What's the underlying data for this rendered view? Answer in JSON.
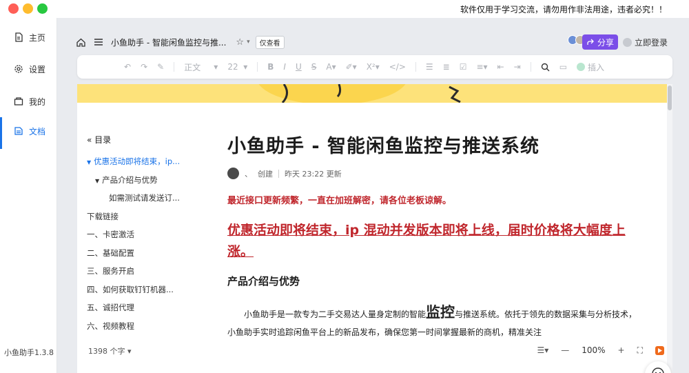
{
  "notice": "软件仅用于学习交流，请勿用作非法用途，违者必究！！",
  "sidebar": {
    "items": [
      {
        "label": "主页",
        "icon": "file-icon"
      },
      {
        "label": "设置",
        "icon": "gear-icon"
      },
      {
        "label": "我的",
        "icon": "folder-icon"
      },
      {
        "label": "文档",
        "icon": "doc-icon"
      }
    ],
    "version": "小鱼助手1.3.8"
  },
  "topbar": {
    "title": "小鱼助手 - 智能闲鱼监控与推...",
    "tag": "仅查看",
    "share_label": "分享",
    "login_label": "立即登录"
  },
  "toolbar": {
    "para_style": "正文",
    "font_size": "22",
    "insert_label": "插入"
  },
  "toc": {
    "header": "目录",
    "items": [
      {
        "label": "优惠活动即将结束，ip...",
        "level": 1,
        "active": true,
        "caret": true
      },
      {
        "label": "产品介绍与优势",
        "level": 2,
        "active": false,
        "caret": true
      },
      {
        "label": "如需测试请发送订...",
        "level": 3,
        "active": false,
        "caret": false
      },
      {
        "label": "下载链接",
        "level": 0,
        "active": false,
        "caret": false
      },
      {
        "label": "一、卡密激活",
        "level": 0,
        "active": false,
        "caret": false
      },
      {
        "label": "二、基础配置",
        "level": 0,
        "active": false,
        "caret": false
      },
      {
        "label": "三、服务开启",
        "level": 0,
        "active": false,
        "caret": false
      },
      {
        "label": "四、如何获取钉钉机器...",
        "level": 0,
        "active": false,
        "caret": false
      },
      {
        "label": "五、诚招代理",
        "level": 0,
        "active": false,
        "caret": false
      },
      {
        "label": "六、视频教程",
        "level": 0,
        "active": false,
        "caret": false
      }
    ],
    "word_count": "1398 个字"
  },
  "doc": {
    "title": "小鱼助手 - 智能闲鱼监控与推送系统",
    "meta_author": "、",
    "meta_created": "创建",
    "meta_updated": "昨天 23:22 更新",
    "red_note": "最近接口更新频繁，一直在加班解密，请各位老板谅解。",
    "red_big": "优惠活动即将结束，ip 混动并发版本即将上线，届时价格将大幅度上涨。",
    "h3": "产品介绍与优势",
    "para_start": "小鱼助手是一款专为二手交易达人量身定制的智能",
    "para_big": "监控",
    "para_end": "与推送系统。依托于领先的数据采集与分析技术，小鱼助手实时追踪闲鱼平台上的新品发布，确保您第一时间掌握最新的商机，精准关注"
  },
  "status": {
    "zoom": "100%"
  },
  "colors": {
    "accent": "#1a73e8",
    "share": "#7b4ee8",
    "red_text": "#c0272d",
    "banner": "#fde27a"
  }
}
